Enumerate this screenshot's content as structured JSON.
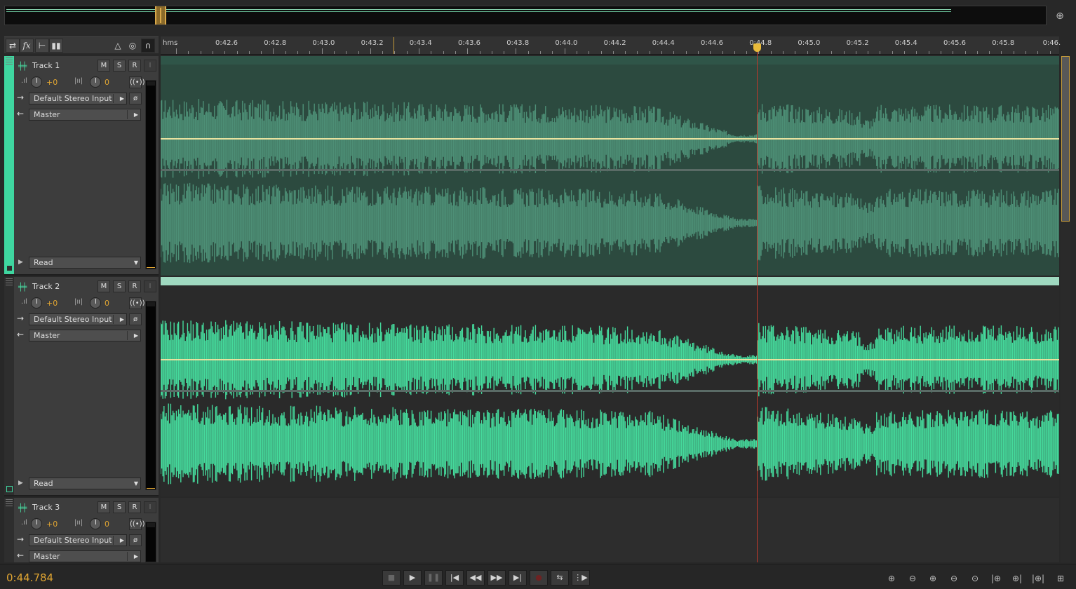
{
  "timecode": "0:44.784",
  "ruler": {
    "unit": "hms",
    "labels": [
      "0:42.6",
      "0:42.8",
      "0:43.0",
      "0:43.2",
      "0:43.4",
      "0:43.6",
      "0:43.8",
      "0:44.0",
      "0:44.2",
      "0:44.4",
      "0:44.6",
      "0:44.8",
      "0:45.0",
      "0:45.2",
      "0:45.4",
      "0:45.6",
      "0:45.8",
      "0:46."
    ]
  },
  "toolbar": {
    "icons": [
      "swap-icon",
      "fx-icon",
      "sends-icon",
      "eq-icon",
      "metronome-icon",
      "record-monitor-icon",
      "headphones-icon"
    ],
    "fx_label": "fx"
  },
  "tracks": [
    {
      "name": "Track 1",
      "mute": "M",
      "solo": "S",
      "arm": "R",
      "input_mon": "I",
      "volume": "+0",
      "pan": "0",
      "input": "Default Stereo Input",
      "output": "Master",
      "automation": "Read",
      "selected": false
    },
    {
      "name": "Track 2",
      "mute": "M",
      "solo": "S",
      "arm": "R",
      "input_mon": "I",
      "volume": "+0",
      "pan": "0",
      "input": "Default Stereo Input",
      "output": "Master",
      "automation": "Read",
      "selected": true
    },
    {
      "name": "Track 3",
      "mute": "M",
      "solo": "S",
      "arm": "R",
      "input_mon": "I",
      "volume": "+0",
      "pan": "0",
      "input": "Default Stereo Input",
      "output": "Master"
    }
  ],
  "colors": {
    "wave_selected": "#45da9c",
    "wave_dim": "#4d8f76",
    "clip_bg_dim": "#2c4a3f",
    "clip_bg": "#2a2a2a",
    "volume_line": "#e8e2a0",
    "playhead": "#c0392b",
    "accent": "#e0a532"
  },
  "transport": [
    "stop-icon",
    "play-icon",
    "pause-icon",
    "go-to-start-icon",
    "rewind-icon",
    "fast-forward-icon",
    "go-to-end-icon",
    "record-icon",
    "loop-icon",
    "skip-selection-icon"
  ],
  "zoom_tools": [
    "zoom-in-amplitude-icon",
    "zoom-out-amplitude-icon",
    "zoom-in-time-icon",
    "zoom-out-time-icon",
    "zoom-out-full-icon",
    "zoom-in-selection-left-icon",
    "zoom-in-selection-right-icon",
    "zoom-to-selection-icon",
    "zoom-tracks-icon"
  ]
}
